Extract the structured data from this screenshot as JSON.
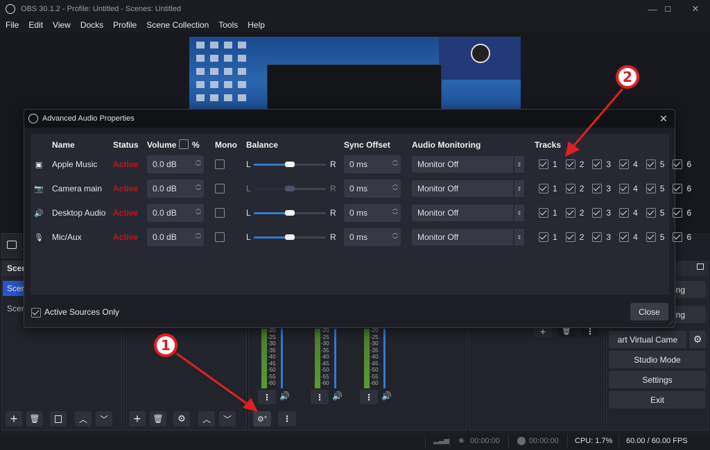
{
  "window": {
    "title": "OBS 30.1.2 - Profile: Untitled - Scenes: Untitled",
    "controls": [
      "minimize",
      "maximize",
      "close"
    ]
  },
  "menu": [
    "File",
    "Edit",
    "View",
    "Docks",
    "Profile",
    "Scene Collection",
    "Tools",
    "Help"
  ],
  "scenes": {
    "header": "Scer",
    "items": [
      "Scer",
      "Scer"
    ],
    "selected_index": 0
  },
  "controls_dock": {
    "buttons": [
      "ing",
      "ing",
      "art Virtual Came",
      "Studio Mode",
      "Settings",
      "Exit"
    ]
  },
  "mixer": {
    "tick_labels": [
      "-20",
      "-25",
      "-30",
      "-35",
      "-40",
      "-45",
      "-50",
      "-55",
      "-60"
    ],
    "channels": 3
  },
  "statusbar": {
    "stream_time": "00:00:00",
    "rec_time": "00:00:00",
    "cpu": "CPU: 1.7%",
    "fps": "60.00 / 60.00 FPS"
  },
  "dialog": {
    "title": "Advanced Audio Properties",
    "headers": {
      "name": "Name",
      "status": "Status",
      "volume": "Volume",
      "percent": "%",
      "mono": "Mono",
      "balance": "Balance",
      "sync": "Sync Offset",
      "monitoring": "Audio Monitoring",
      "tracks": "Tracks"
    },
    "balance_left": "L",
    "balance_right": "R",
    "rows": [
      {
        "icon": "audio-output-icon",
        "name": "Apple Music",
        "status": "Active",
        "volume": "0.0 dB",
        "mono": false,
        "balance": 0.5,
        "balance_enabled": true,
        "sync": "0 ms",
        "monitoring": "Monitor Off",
        "tracks": [
          true,
          true,
          true,
          true,
          true,
          true
        ]
      },
      {
        "icon": "camera-icon",
        "name": "Camera main",
        "status": "Active",
        "volume": "0.0 dB",
        "mono": false,
        "balance": 0.5,
        "balance_enabled": false,
        "sync": "0 ms",
        "monitoring": "Monitor Off",
        "tracks": [
          true,
          true,
          true,
          true,
          true,
          true
        ]
      },
      {
        "icon": "speaker-icon",
        "name": "Desktop Audio",
        "status": "Active",
        "volume": "0.0 dB",
        "mono": false,
        "balance": 0.5,
        "balance_enabled": true,
        "sync": "0 ms",
        "monitoring": "Monitor Off",
        "tracks": [
          true,
          true,
          true,
          true,
          true,
          true
        ]
      },
      {
        "icon": "microphone-icon",
        "name": "Mic/Aux",
        "status": "Active",
        "volume": "0.0 dB",
        "mono": false,
        "balance": 0.5,
        "balance_enabled": true,
        "sync": "0 ms",
        "monitoring": "Monitor Off",
        "tracks": [
          true,
          true,
          true,
          true,
          true,
          true
        ]
      }
    ],
    "track_numbers": [
      "1",
      "2",
      "3",
      "4",
      "5",
      "6"
    ],
    "active_only_label": "Active Sources Only",
    "active_only_checked": true,
    "close_label": "Close"
  },
  "annotations": [
    "1",
    "2"
  ],
  "colors": {
    "accent": "#2f7bd6",
    "active_status": "#c2141c",
    "annotation": "#e02020"
  }
}
